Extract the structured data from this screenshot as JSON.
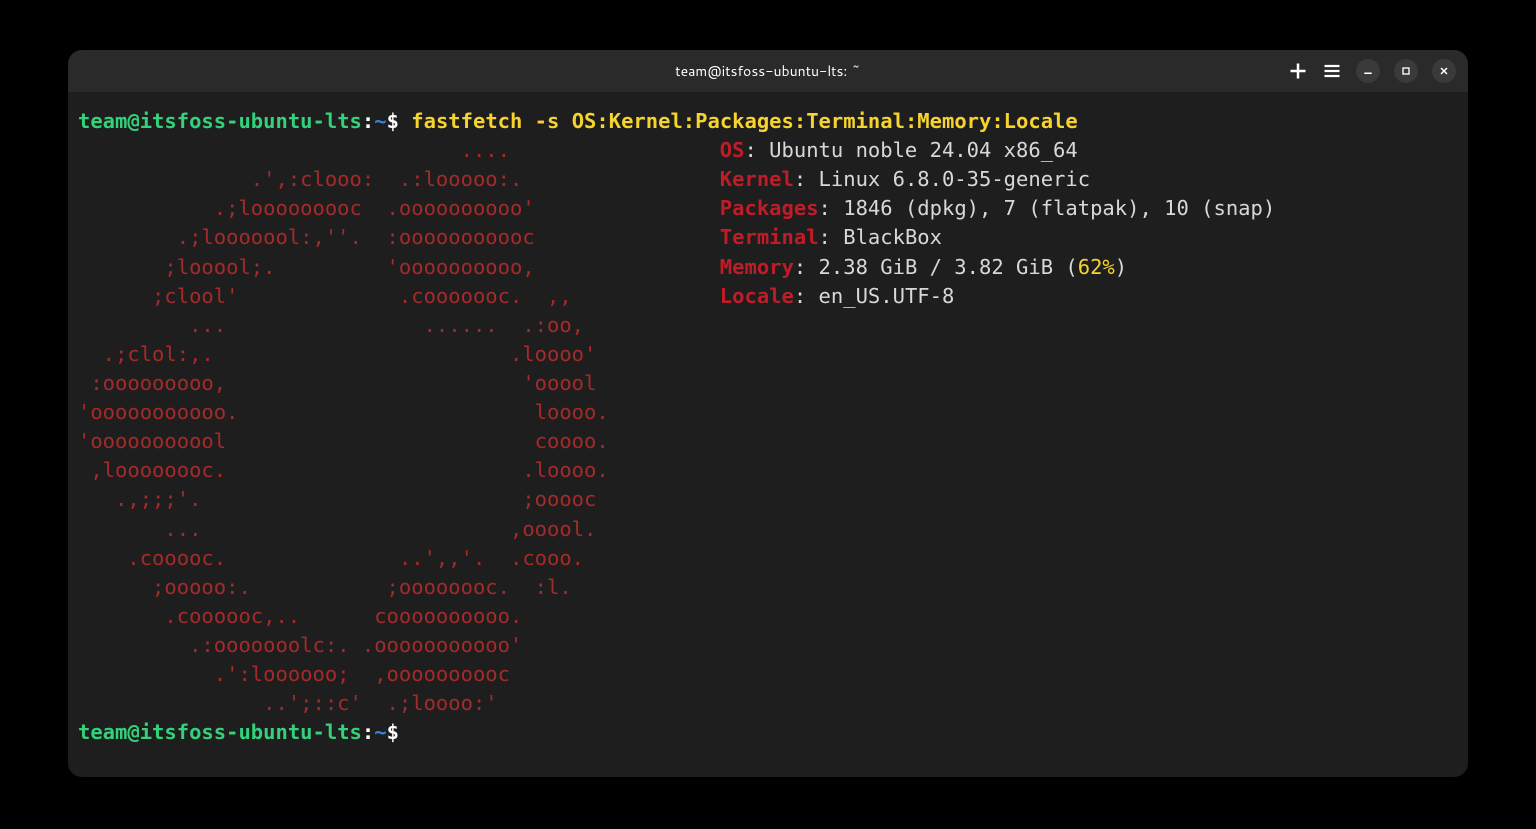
{
  "window": {
    "title": "team@itsfoss-ubuntu-lts: ~"
  },
  "prompt1": {
    "user": "team",
    "at": "@",
    "host": "itsfoss-ubuntu-lts",
    "colon": ":",
    "path": "~",
    "dollar": "$ ",
    "command": "fastfetch -s OS:Kernel:Packages:Terminal:Memory:Locale"
  },
  "prompt2": {
    "user": "team",
    "at": "@",
    "host": "itsfoss-ubuntu-lts",
    "colon": ":",
    "path": "~",
    "dollar": "$ "
  },
  "logo": [
    "                               ....              ",
    "              .',:clooo:  .:looooo:.             ",
    "           .;looooooooc  .oooooooooo'            ",
    "        .;looooool:,''.  :ooooooooooc            ",
    "       ;looool;.         'oooooooooo,            ",
    "      ;clool'             .cooooooc.  ,,         ",
    "         ...                ......  .:oo,        ",
    "  .;clol:,.                        .loooo'       ",
    " :ooooooooo,                        'ooool       ",
    "'ooooooooooo.                        loooo.      ",
    "'ooooooooool                         coooo.      ",
    " ,loooooooc.                        .loooo.      ",
    "   .,;;;'.                          ;ooooc       ",
    "       ...                         ,ooool.       ",
    "    .cooooc.              ..',,'.  .cooo.        ",
    "      ;ooooo:.           ;oooooooc.  :l.         ",
    "       .coooooc,..      coooooooooo.             ",
    "         .:ooooooolc:. .ooooooooooo'             ",
    "           .':loooooo;  ,oooooooooc              ",
    "               ..';::c'  .;loooo:'               "
  ],
  "info": [
    {
      "key": "OS",
      "sep": ": ",
      "val": "Ubuntu noble 24.04 x86_64"
    },
    {
      "key": "Kernel",
      "sep": ": ",
      "val": "Linux 6.8.0-35-generic"
    },
    {
      "key": "Packages",
      "sep": ": ",
      "val": "1846 (dpkg), 7 (flatpak), 10 (snap)"
    },
    {
      "key": "Terminal",
      "sep": ": ",
      "val": "BlackBox"
    },
    {
      "key": "Memory",
      "sep": ": ",
      "val_pre": "2.38 GiB / 3.82 GiB (",
      "val_hl": "62%",
      "val_post": ")"
    },
    {
      "key": "Locale",
      "sep": ": ",
      "val": "en_US.UTF-8"
    }
  ],
  "logo_pad": "   "
}
